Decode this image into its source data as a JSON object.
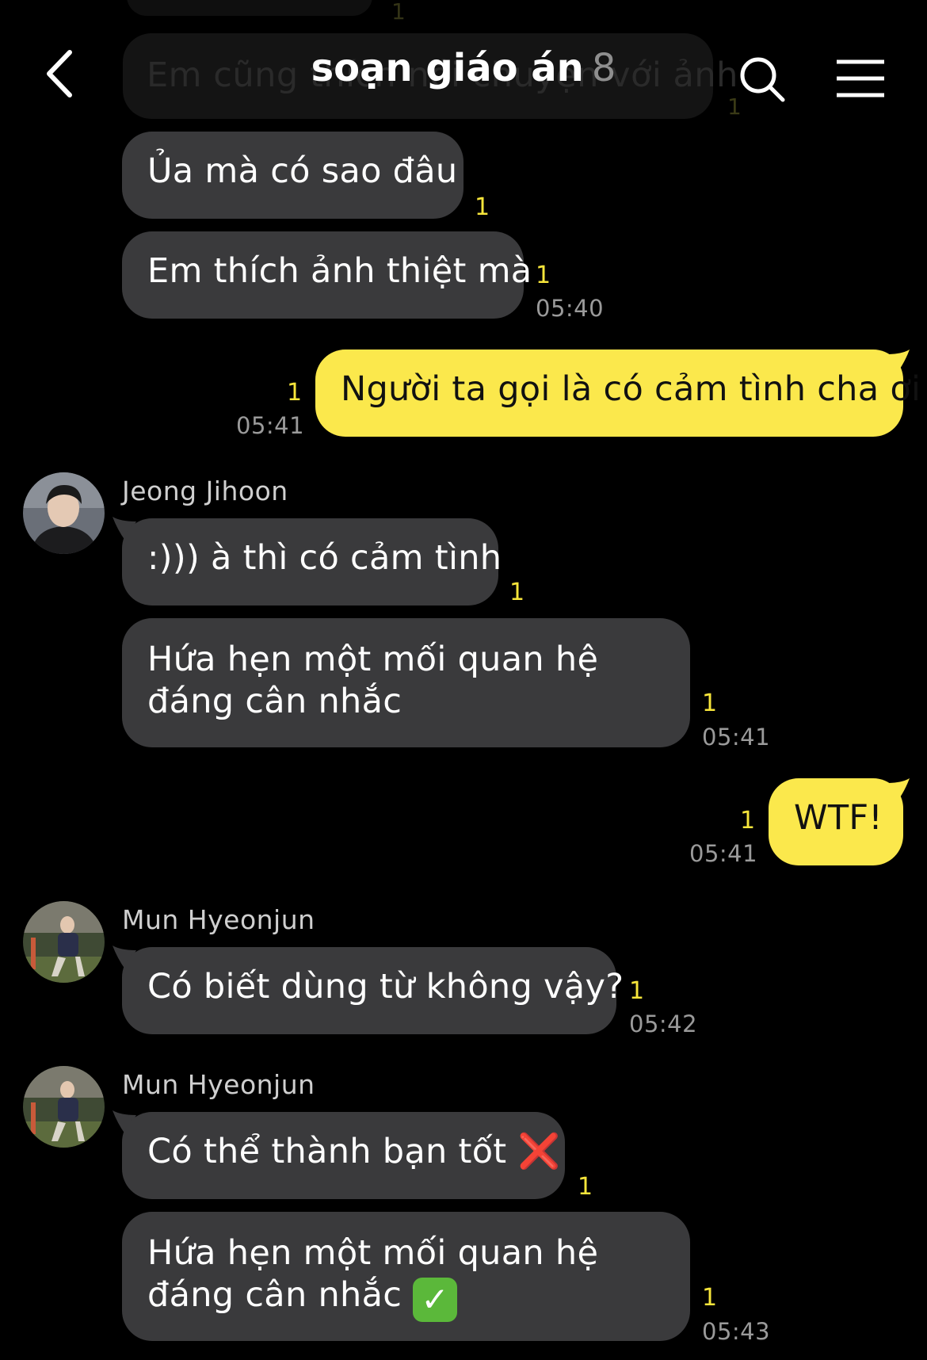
{
  "header": {
    "title": "soạn giáo án",
    "member_count": "8"
  },
  "ghost": {
    "text": "Em cũng thích nói chuyện với ảnh",
    "count": "1",
    "top_count": "1"
  },
  "messages": [
    {
      "text": "Ủa mà có sao đâu",
      "unread": "1"
    },
    {
      "text": "Em thích ảnh thiệt mà",
      "unread": "1",
      "time": "05:40"
    },
    {
      "text": "Người ta gọi là có cảm tình cha ơi",
      "unread": "1",
      "time": "05:41"
    },
    {
      "sender": "Jeong Jihoon",
      "text": ":))) à thì có cảm tình",
      "unread": "1"
    },
    {
      "text": "Hứa hẹn một mối quan hệ đáng cân nhắc",
      "unread": "1",
      "time": "05:41"
    },
    {
      "text": "WTF!",
      "unread": "1",
      "time": "05:41"
    },
    {
      "sender": "Mun Hyeonjun",
      "text": "Có biết dùng từ không vậy?",
      "unread": "1",
      "time": "05:42"
    },
    {
      "sender": "Mun Hyeonjun",
      "text": "Có thể thành bạn tốt",
      "emoji": "❌",
      "unread": "1"
    },
    {
      "text": "Hứa hẹn một mối quan hệ đáng cân nhắc",
      "emoji": "✓",
      "unread": "1",
      "time": "05:43"
    }
  ],
  "icons": [
    "back-chevron-icon",
    "search-icon",
    "menu-icon",
    "cross-mark-emoji",
    "check-mark-emoji"
  ],
  "colors": {
    "outgoing": "#fbe84c",
    "incoming": "#3a3a3c",
    "unread": "#f7e53b"
  }
}
